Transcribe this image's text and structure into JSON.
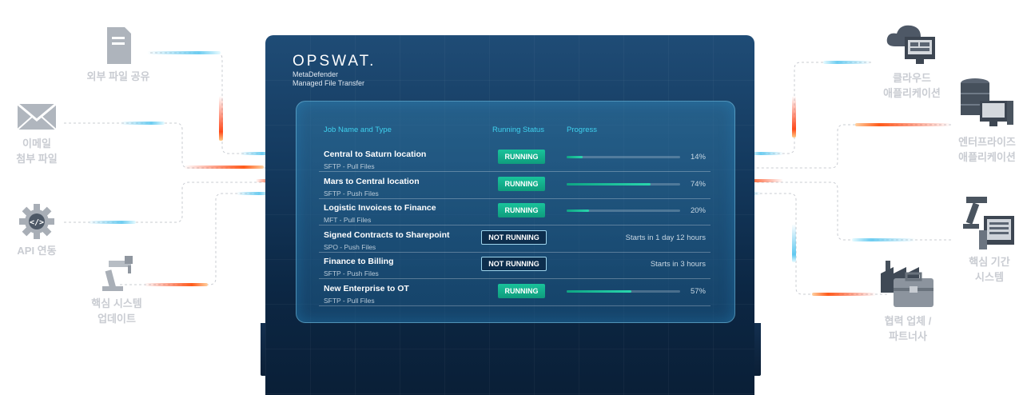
{
  "brand": {
    "logo": "OPSWAT.",
    "product_line1": "MetaDefender",
    "product_line2": "Managed File Transfer"
  },
  "table": {
    "headers": {
      "job": "Job Name and Type",
      "status": "Running Status",
      "progress": "Progress"
    },
    "rows": [
      {
        "name": "Central to Saturn location",
        "type": "SFTP - Pull Files",
        "status": "RUNNING",
        "running": true,
        "progress": 0.14,
        "progress_label": "14%",
        "schedule": ""
      },
      {
        "name": "Mars to Central location",
        "type": "SFTP - Push Files",
        "status": "RUNNING",
        "running": true,
        "progress": 0.74,
        "progress_label": "74%",
        "schedule": ""
      },
      {
        "name": "Logistic Invoices to Finance",
        "type": "MFT - Pull Files",
        "status": "RUNNING",
        "running": true,
        "progress": 0.2,
        "progress_label": "20%",
        "schedule": ""
      },
      {
        "name": "Signed Contracts to Sharepoint",
        "type": "SPO - Push Files",
        "status": "NOT RUNNING",
        "running": false,
        "progress": null,
        "progress_label": "",
        "schedule": "Starts in 1 day 12 hours"
      },
      {
        "name": "Finance to Billing",
        "type": "SFTP - Push Files",
        "status": "NOT RUNNING",
        "running": false,
        "progress": null,
        "progress_label": "",
        "schedule": "Starts in 3 hours"
      },
      {
        "name": "New Enterprise to OT",
        "type": "SFTP - Pull Files",
        "status": "RUNNING",
        "running": true,
        "progress": 0.57,
        "progress_label": "57%",
        "schedule": ""
      }
    ]
  },
  "left_nodes": [
    {
      "line1": "외부 파일 공유",
      "line2": "",
      "icon": "document-icon"
    },
    {
      "line1": "이메일",
      "line2": "첨부 파일",
      "icon": "envelope-icon"
    },
    {
      "line1": "API 연동",
      "line2": "",
      "icon": "api-gear-icon"
    },
    {
      "line1": "핵심 시스템",
      "line2": "업데이트",
      "icon": "robot-arm-icon"
    }
  ],
  "right_nodes": [
    {
      "line1": "클라우드",
      "line2": "애플리케이션",
      "icon": "cloud-app-icon"
    },
    {
      "line1": "엔터프라이즈",
      "line2": "애플리케이션",
      "icon": "server-desktop-icon"
    },
    {
      "line1": "핵심 기간",
      "line2": "시스템",
      "icon": "robot-panel-icon"
    },
    {
      "line1": "협력 업체 /",
      "line2": "파트너사",
      "icon": "factory-briefcase-icon"
    }
  ],
  "colors": {
    "running": "#14b28f",
    "accent": "#3fd1ee",
    "panel": "#143a5f",
    "label": "#c9ccd2",
    "flow_blue": "#5ec8f0",
    "flow_red": "#ff3a1a"
  }
}
